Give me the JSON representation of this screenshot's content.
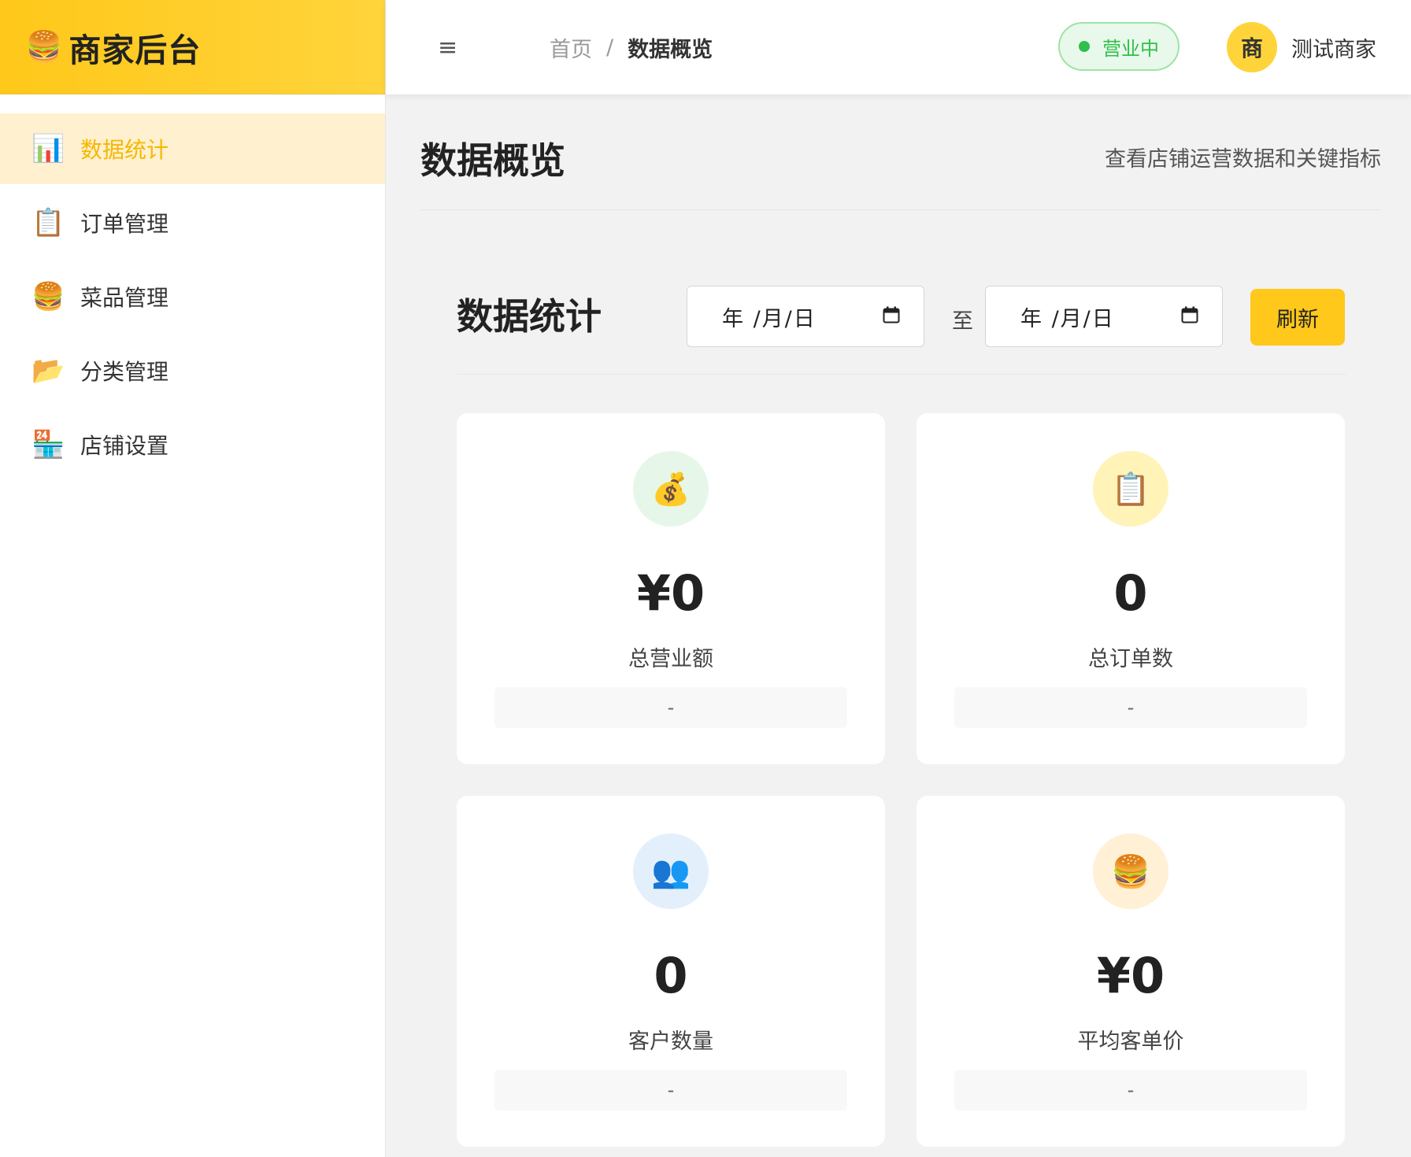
{
  "brand": {
    "icon": "🍔",
    "title": "商家后台"
  },
  "sidebar": {
    "items": [
      {
        "icon": "📊",
        "label": "数据统计",
        "active": true
      },
      {
        "icon": "📋",
        "label": "订单管理",
        "active": false
      },
      {
        "icon": "🍔",
        "label": "菜品管理",
        "active": false
      },
      {
        "icon": "📂",
        "label": "分类管理",
        "active": false
      },
      {
        "icon": "🏪",
        "label": "店铺设置",
        "active": false
      }
    ]
  },
  "topbar": {
    "menu_icon": "≡",
    "breadcrumb": {
      "home": "首页",
      "separator": "/",
      "current": "数据概览"
    },
    "status": "营业中",
    "user": {
      "avatar": "商",
      "name": "测试商家"
    }
  },
  "page": {
    "title": "数据概览",
    "subtitle": "查看店铺运营数据和关键指标"
  },
  "stats": {
    "title": "数据统计",
    "date_start": "年 /月/日",
    "date_end": "年 /月/日",
    "date_separator": "至",
    "refresh_label": "刷新",
    "cards": [
      {
        "icon": "💰",
        "value": "¥0",
        "label": "总营业额",
        "foot": "-",
        "icon_bg": "#e6f7e9"
      },
      {
        "icon": "📋",
        "value": "0",
        "label": "总订单数",
        "foot": "-",
        "icon_bg": "#fff3b8"
      },
      {
        "icon": "👥",
        "value": "0",
        "label": "客户数量",
        "foot": "-",
        "icon_bg": "#e3f0fc"
      },
      {
        "icon": "🍔",
        "value": "¥0",
        "label": "平均客单价",
        "foot": "-",
        "icon_bg": "#fff0d6"
      }
    ]
  },
  "colors": {
    "accent": "#ffc81a",
    "active_text": "#f5b800",
    "active_bg": "#fff0cf",
    "status_green": "#2fbf4a"
  }
}
